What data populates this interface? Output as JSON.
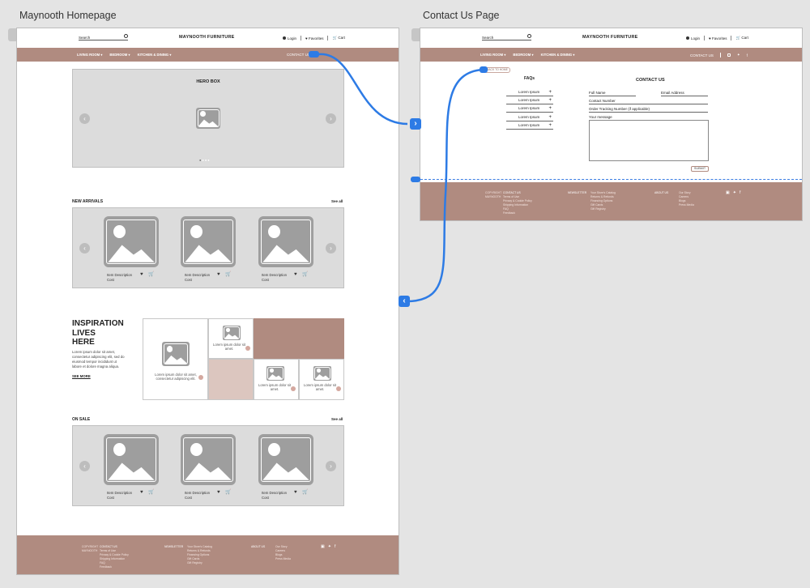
{
  "frames": {
    "home_label": "Maynooth Homepage",
    "contact_label": "Contact Us Page"
  },
  "header": {
    "search_placeholder": "Search",
    "brand": "MAYNOOTH FURNITURE",
    "login": "Login",
    "favorites": "Favorites",
    "cart": "Cart"
  },
  "nav": {
    "items": [
      "LIVING ROOM ▾",
      "BEDROOM ▾",
      "KITCHEN & DINING ▾"
    ],
    "contact": "CONTACT US"
  },
  "home": {
    "hero_title": "HERO BOX",
    "new_arrivals": {
      "title": "NEW ARRIVALS",
      "see_all": "See all",
      "items": [
        {
          "desc": "Item Description",
          "cost": "Cost"
        },
        {
          "desc": "Item Description",
          "cost": "Cost"
        },
        {
          "desc": "Item Description",
          "cost": "Cost"
        }
      ]
    },
    "inspiration": {
      "title_line1": "INSPIRATION",
      "title_line2": "LIVES",
      "title_line3": "HERE",
      "body": "Lorem ipsum dolor sit amet, consectetur adipiscing elit, sed do eiusmod tempor incididunt ut labore et dolore magna aliqua.",
      "see_more": "SEE MORE",
      "tile_big_caption": "Lorem ipsum dolor sit amet, consectetur adipiscing elit.",
      "tile_small_caption": "Lorem ipsum dolor sit amet."
    },
    "on_sale": {
      "title": "ON SALE",
      "see_all": "See all",
      "items": [
        {
          "desc": "Item Description",
          "cost": "Cost"
        },
        {
          "desc": "Item Description",
          "cost": "Cost"
        },
        {
          "desc": "Item Description",
          "cost": "Cost"
        }
      ]
    }
  },
  "footer": {
    "col1": [
      "COPYRIGHT",
      "MAYNOOTH"
    ],
    "col2": [
      "CONTACT US",
      "Terms of Use",
      "Privacy & Cookie Policy",
      "Shipping Information",
      "FAQ",
      "Feedback"
    ],
    "col3": [
      "NEWSLETTER"
    ],
    "col4": [
      "Your Store's Catalog",
      "Returns & Refunds",
      "Financing Options",
      "Gift Cards",
      "Gift Registry"
    ],
    "col5": [
      "ABOUT US"
    ],
    "col6": [
      "Our Story",
      "Careers",
      "Blogs",
      "Press Media"
    ]
  },
  "contact": {
    "back_link": "BACK TO HOME",
    "faqs_title": "FAQs",
    "faq_items": [
      "Lorem Ipsum",
      "Lorem Ipsum",
      "Lorem Ipsum",
      "Lorem Ipsum",
      "Lorem Ipsum"
    ],
    "form_title": "CONTACT US",
    "full_name": "Full Name",
    "email": "Email Address",
    "contact_number": "Contact Number",
    "order_tracking": "Order Tracking Number (if applicable)",
    "message": "Your message",
    "submit": "SUBMIT"
  },
  "colors": {
    "accent": "#b08b80",
    "link": "#2d7be5"
  }
}
